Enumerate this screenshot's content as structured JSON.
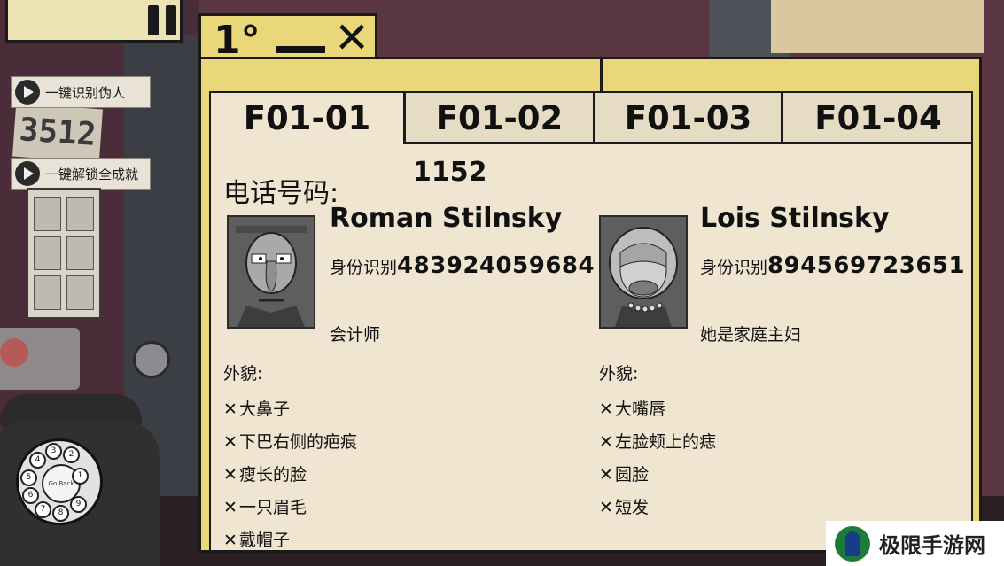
{
  "folder": {
    "number_label": "1°",
    "minimize_icon": "minimize-dash-icon",
    "close_icon": "close-x-icon"
  },
  "side_buttons": [
    {
      "label": "一键识别伪人",
      "icon": "play-icon"
    },
    {
      "label": "一键解锁全成就",
      "icon": "play-icon"
    }
  ],
  "background": {
    "note_text": "3512",
    "dial_center": "Go Back",
    "dial_numbers": [
      "1",
      "2",
      "3",
      "4",
      "5",
      "6",
      "7",
      "8",
      "9"
    ]
  },
  "tabs": [
    {
      "label": "F01-01",
      "active": true
    },
    {
      "label": "F01-02",
      "active": false
    },
    {
      "label": "F01-03",
      "active": false
    },
    {
      "label": "F01-04",
      "active": false
    }
  ],
  "record": {
    "phone_label": "电话号码:",
    "phone_value": "1152",
    "persons": [
      {
        "name": "Roman Stilnsky",
        "id_label": "身份识别",
        "id_number": "483924059684",
        "occupation": "会计师",
        "appearance_label": "外貌:",
        "features": [
          "大鼻子",
          "下巴右侧的疤痕",
          "瘦长的脸",
          "一只眉毛",
          "戴帽子"
        ]
      },
      {
        "name": "Lois Stilnsky",
        "id_label": "身份识别",
        "id_number": "894569723651",
        "occupation": "她是家庭主妇",
        "appearance_label": "外貌:",
        "features": [
          "大嘴唇",
          "左脸颊上的痣",
          "圆脸",
          "短发"
        ]
      }
    ]
  },
  "watermark": {
    "text": "极限手游网"
  },
  "colors": {
    "folder": "#e9d77a",
    "card": "#efe5d0",
    "ink": "#111111",
    "wall": "#5b3643"
  }
}
